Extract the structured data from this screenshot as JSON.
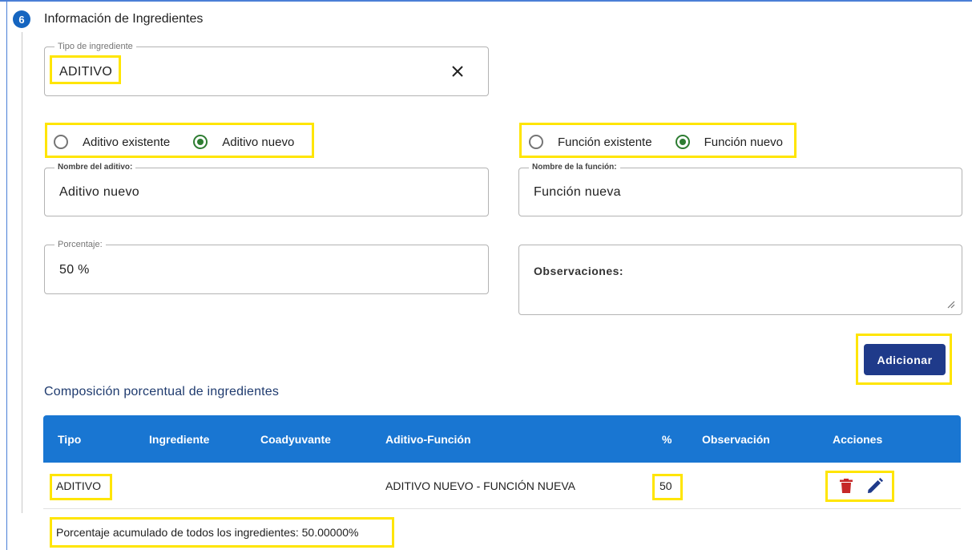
{
  "section": {
    "step_number": "6",
    "title": "Información de Ingredientes"
  },
  "tipo_ingrediente": {
    "label": "Tipo de ingrediente",
    "value": "ADITIVO"
  },
  "aditivo_radio": {
    "options": [
      "Aditivo existente",
      "Aditivo nuevo"
    ],
    "selected": "Aditivo nuevo"
  },
  "funcion_radio": {
    "options": [
      "Función existente",
      "Función nuevo"
    ],
    "selected": "Función nuevo"
  },
  "nombre_aditivo": {
    "label": "Nombre del aditivo:",
    "value": "Aditivo nuevo"
  },
  "nombre_funcion": {
    "label": "Nombre de la función:",
    "value": "Función nueva"
  },
  "porcentaje": {
    "label": "Porcentaje:",
    "value": "50 %"
  },
  "observaciones": {
    "label": "Observaciones:"
  },
  "add_button_label": "Adicionar",
  "composition": {
    "title": "Composición porcentual de ingredientes",
    "columns": [
      "Tipo",
      "Ingrediente",
      "Coadyuvante",
      "Aditivo-Función",
      "%",
      "Observación",
      "Acciones"
    ],
    "rows": [
      {
        "tipo": "ADITIVO",
        "ingrediente": "",
        "coadyuvante": "",
        "aditivo_funcion": "ADITIVO NUEVO - FUNCIÓN NUEVA",
        "porcentaje": "50",
        "observacion": ""
      }
    ],
    "footer": "Porcentaje acumulado de todos los ingredientes: 50.00000%"
  },
  "icons": {
    "clear": "close-icon",
    "delete": "trash-icon",
    "edit": "pencil-icon"
  },
  "colors": {
    "primary": "#1976d2",
    "button": "#1f3a8a",
    "radio_checked": "#2e7d32",
    "delete_icon": "#c62828",
    "edit_icon": "#1f3a8a",
    "highlight": "#ffe500",
    "step_badge": "#1565c0"
  }
}
